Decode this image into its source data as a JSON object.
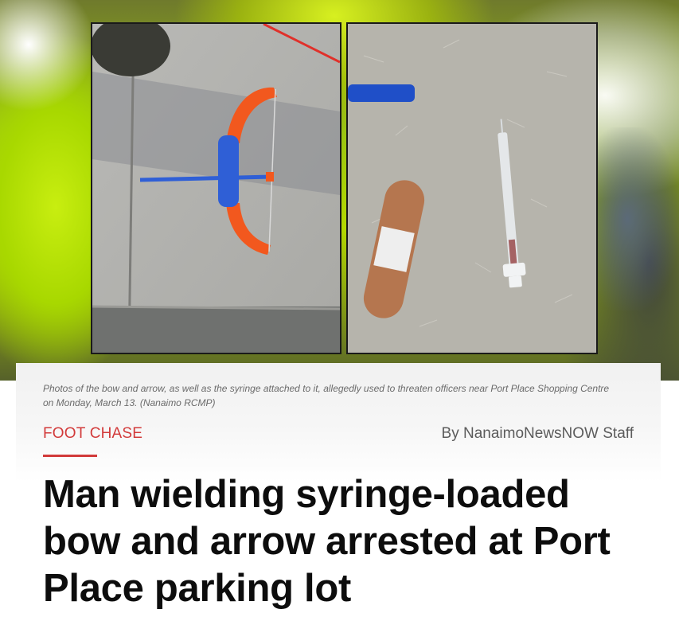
{
  "article": {
    "photo_alt_left": "Toy bow and arrow on pavement",
    "photo_alt_right": "Syringe and bandage on carpet",
    "caption": "Photos of the bow and arrow, as well as the syringe attached to it, allegedly used to threaten officers near Port Place Shopping Centre on Monday, March 13. (Nanaimo RCMP)",
    "category": "FOOT CHASE",
    "byline": "By NanaimoNewsNOW Staff",
    "headline": "Man wielding syringe-loaded bow and arrow arrested at Port Place parking lot"
  },
  "colors": {
    "accent": "#d23a3a",
    "headline": "#0d0d0d",
    "caption": "#6b6b6b",
    "byline": "#5c5c5c"
  }
}
